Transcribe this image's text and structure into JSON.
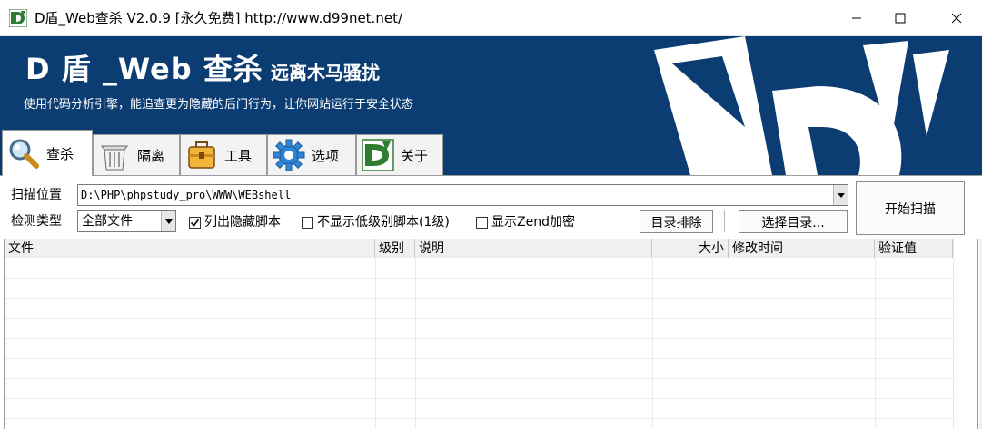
{
  "window": {
    "title": "D盾_Web查杀 V2.0.9 [永久免费] http://www.d99net.net/",
    "minimize_icon": "minimize-icon",
    "maximize_icon": "maximize-icon",
    "close_icon": "close-icon"
  },
  "banner": {
    "title": "D 盾 _Web 查杀",
    "subtitle": "远离木马骚扰",
    "description": "使用代码分析引擎，能追查更为隐藏的后门行为，让你网站运行于安全状态",
    "colors": {
      "background": "#0c3d72",
      "text": "#ffffff"
    }
  },
  "tabs": [
    {
      "label": "查杀",
      "icon": "magnifier-icon",
      "active": true
    },
    {
      "label": "隔离",
      "icon": "trash-bin-icon",
      "active": false
    },
    {
      "label": "工具",
      "icon": "toolbox-icon",
      "active": false
    },
    {
      "label": "选项",
      "icon": "gear-icon",
      "active": false
    },
    {
      "label": "关于",
      "icon": "d-shield-logo-icon",
      "active": false
    }
  ],
  "scan": {
    "location_label": "扫描位置",
    "location_value": "D:\\PHP\\phpstudy_pro\\WWW\\WEBshell",
    "type_label": "检测类型",
    "type_value": "全部文件",
    "options": [
      {
        "label": "列出隐藏脚本",
        "checked": true
      },
      {
        "label": "不显示低级别脚本(1级)",
        "checked": false
      },
      {
        "label": "显示Zend加密",
        "checked": false
      }
    ],
    "exclude_button": "目录排除",
    "select_dir_button": "选择目录...",
    "start_button": "开始扫描"
  },
  "results": {
    "columns": [
      "文件",
      "级别",
      "说明",
      "大小",
      "修改时间",
      "验证值"
    ],
    "rows": []
  }
}
